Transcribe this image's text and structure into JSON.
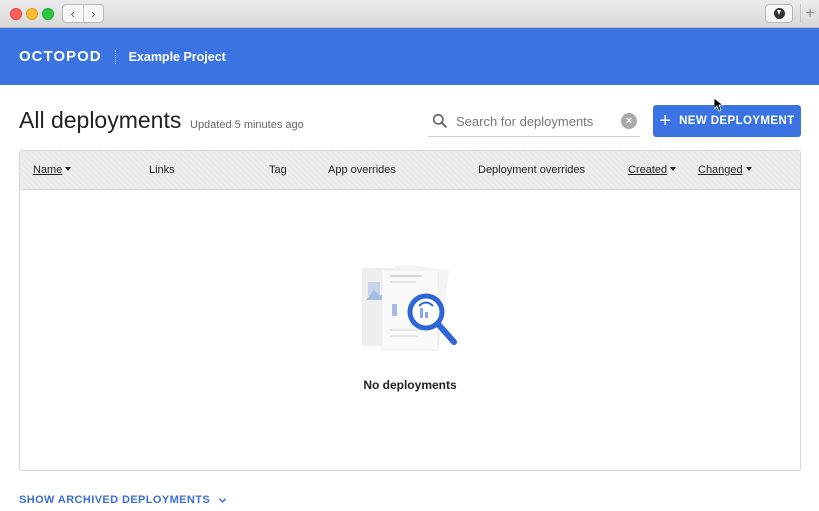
{
  "app": {
    "brand": "OCTOPOD",
    "project": "Example Project"
  },
  "page": {
    "title": "All deployments",
    "updated": "Updated 5 minutes ago"
  },
  "search": {
    "placeholder": "Search for deployments",
    "value": ""
  },
  "actions": {
    "new_deployment": "NEW DEPLOYMENT"
  },
  "table": {
    "columns": [
      "Name",
      "Links",
      "Tag",
      "App overrides",
      "Deployment overrides",
      "Created",
      "Changed"
    ],
    "empty_message": "No deployments"
  },
  "footer": {
    "show_archived": "SHOW ARCHIVED DEPLOYMENTS"
  },
  "colors": {
    "primary": "#3b73e3",
    "link": "#3b6fd6"
  },
  "icons": [
    "back-icon",
    "forward-icon",
    "download-icon",
    "plus-icon",
    "search-icon",
    "clear-icon",
    "sort-caret-icon",
    "magnifier-illustration",
    "chevron-down-icon"
  ]
}
